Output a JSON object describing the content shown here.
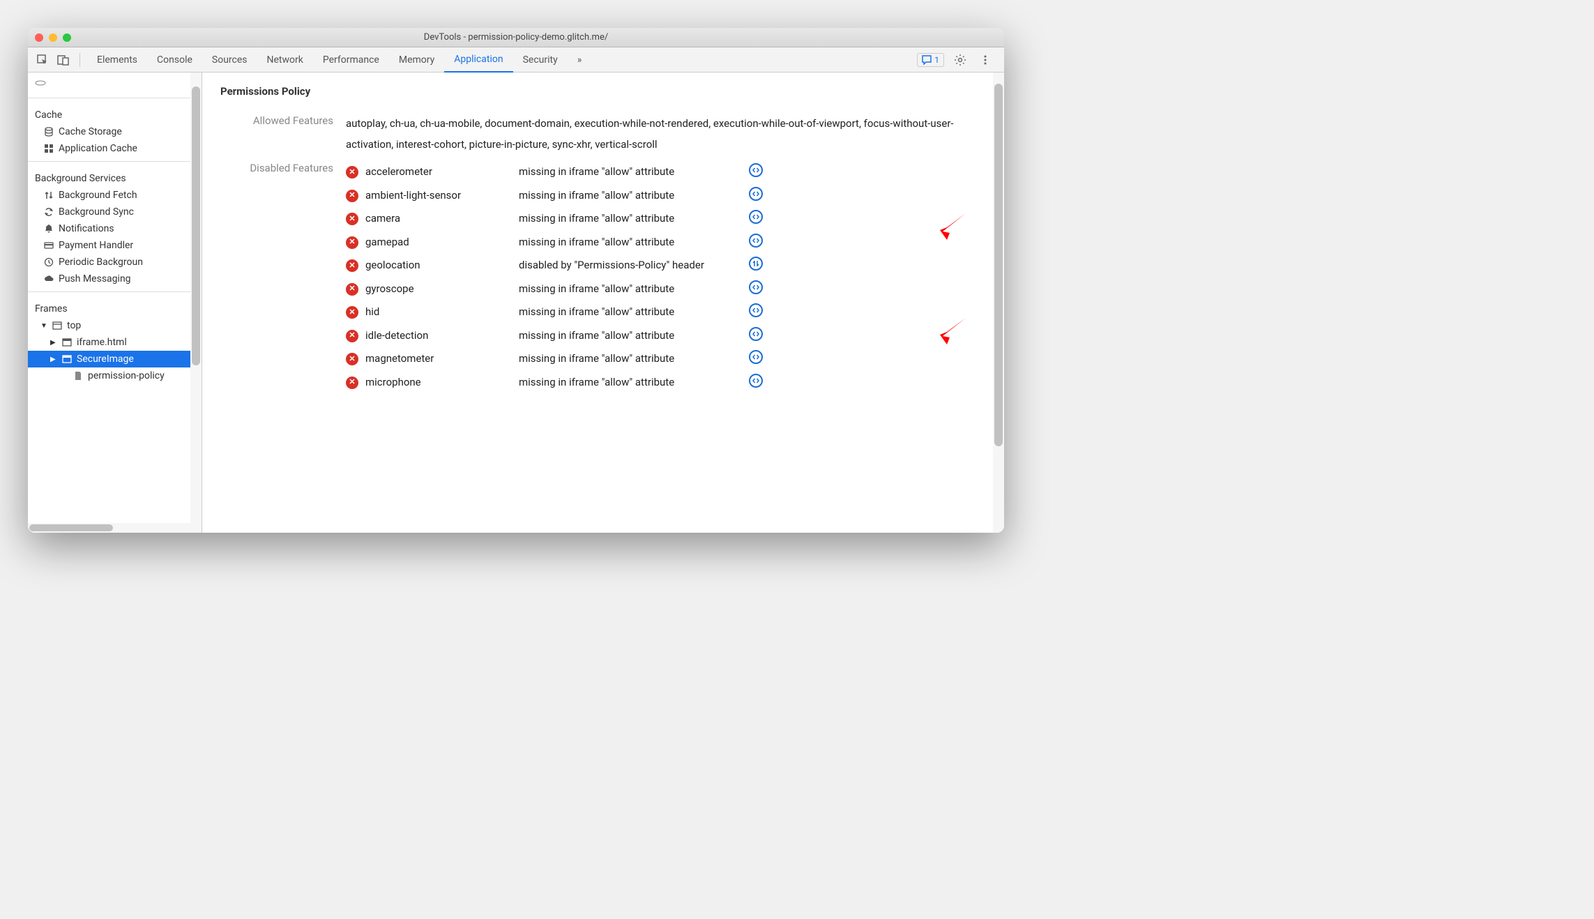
{
  "window": {
    "title": "DevTools - permission-policy-demo.glitch.me/"
  },
  "toolbar": {
    "tabs": [
      "Elements",
      "Console",
      "Sources",
      "Network",
      "Performance",
      "Memory",
      "Application",
      "Security"
    ],
    "active_tab": "Application",
    "issues_count": "1"
  },
  "sidebar": {
    "sections": [
      {
        "title": "Cache",
        "items": [
          {
            "icon": "database-icon",
            "label": "Cache Storage"
          },
          {
            "icon": "grid-icon",
            "label": "Application Cache"
          }
        ]
      },
      {
        "title": "Background Services",
        "items": [
          {
            "icon": "updown-arrows-icon",
            "label": "Background Fetch"
          },
          {
            "icon": "sync-icon",
            "label": "Background Sync"
          },
          {
            "icon": "bell-icon",
            "label": "Notifications"
          },
          {
            "icon": "card-icon",
            "label": "Payment Handler"
          },
          {
            "icon": "clock-icon",
            "label": "Periodic Backgroun"
          },
          {
            "icon": "cloud-icon",
            "label": "Push Messaging"
          }
        ]
      }
    ],
    "frames": {
      "title": "Frames",
      "tree": [
        {
          "depth": 0,
          "icon": "window-icon",
          "label": "top",
          "expanded": true
        },
        {
          "depth": 1,
          "icon": "frame-icon",
          "label": "iframe.html",
          "expanded": false
        },
        {
          "depth": 1,
          "icon": "frame-icon",
          "label": "SecureImage",
          "expanded": false,
          "selected": true
        },
        {
          "depth": 2,
          "icon": "file-icon",
          "label": "permission-policy"
        }
      ]
    }
  },
  "main": {
    "title": "Permissions Policy",
    "allowed": {
      "label": "Allowed Features",
      "value": "autoplay, ch-ua, ch-ua-mobile, document-domain, execution-while-not-rendered, execution-while-out-of-viewport, focus-without-user-activation, interest-cohort, picture-in-picture, sync-xhr, vertical-scroll"
    },
    "disabled": {
      "label": "Disabled Features",
      "rows": [
        {
          "name": "accelerometer",
          "reason": "missing in iframe \"allow\" attribute",
          "link": "code"
        },
        {
          "name": "ambient-light-sensor",
          "reason": "missing in iframe \"allow\" attribute",
          "link": "code"
        },
        {
          "name": "camera",
          "reason": "missing in iframe \"allow\" attribute",
          "link": "code"
        },
        {
          "name": "gamepad",
          "reason": "missing in iframe \"allow\" attribute",
          "link": "code"
        },
        {
          "name": "geolocation",
          "reason": "disabled by \"Permissions-Policy\" header",
          "link": "network"
        },
        {
          "name": "gyroscope",
          "reason": "missing in iframe \"allow\" attribute",
          "link": "code"
        },
        {
          "name": "hid",
          "reason": "missing in iframe \"allow\" attribute",
          "link": "code"
        },
        {
          "name": "idle-detection",
          "reason": "missing in iframe \"allow\" attribute",
          "link": "code"
        },
        {
          "name": "magnetometer",
          "reason": "missing in iframe \"allow\" attribute",
          "link": "code"
        },
        {
          "name": "microphone",
          "reason": "missing in iframe \"allow\" attribute",
          "link": "code"
        }
      ]
    }
  }
}
